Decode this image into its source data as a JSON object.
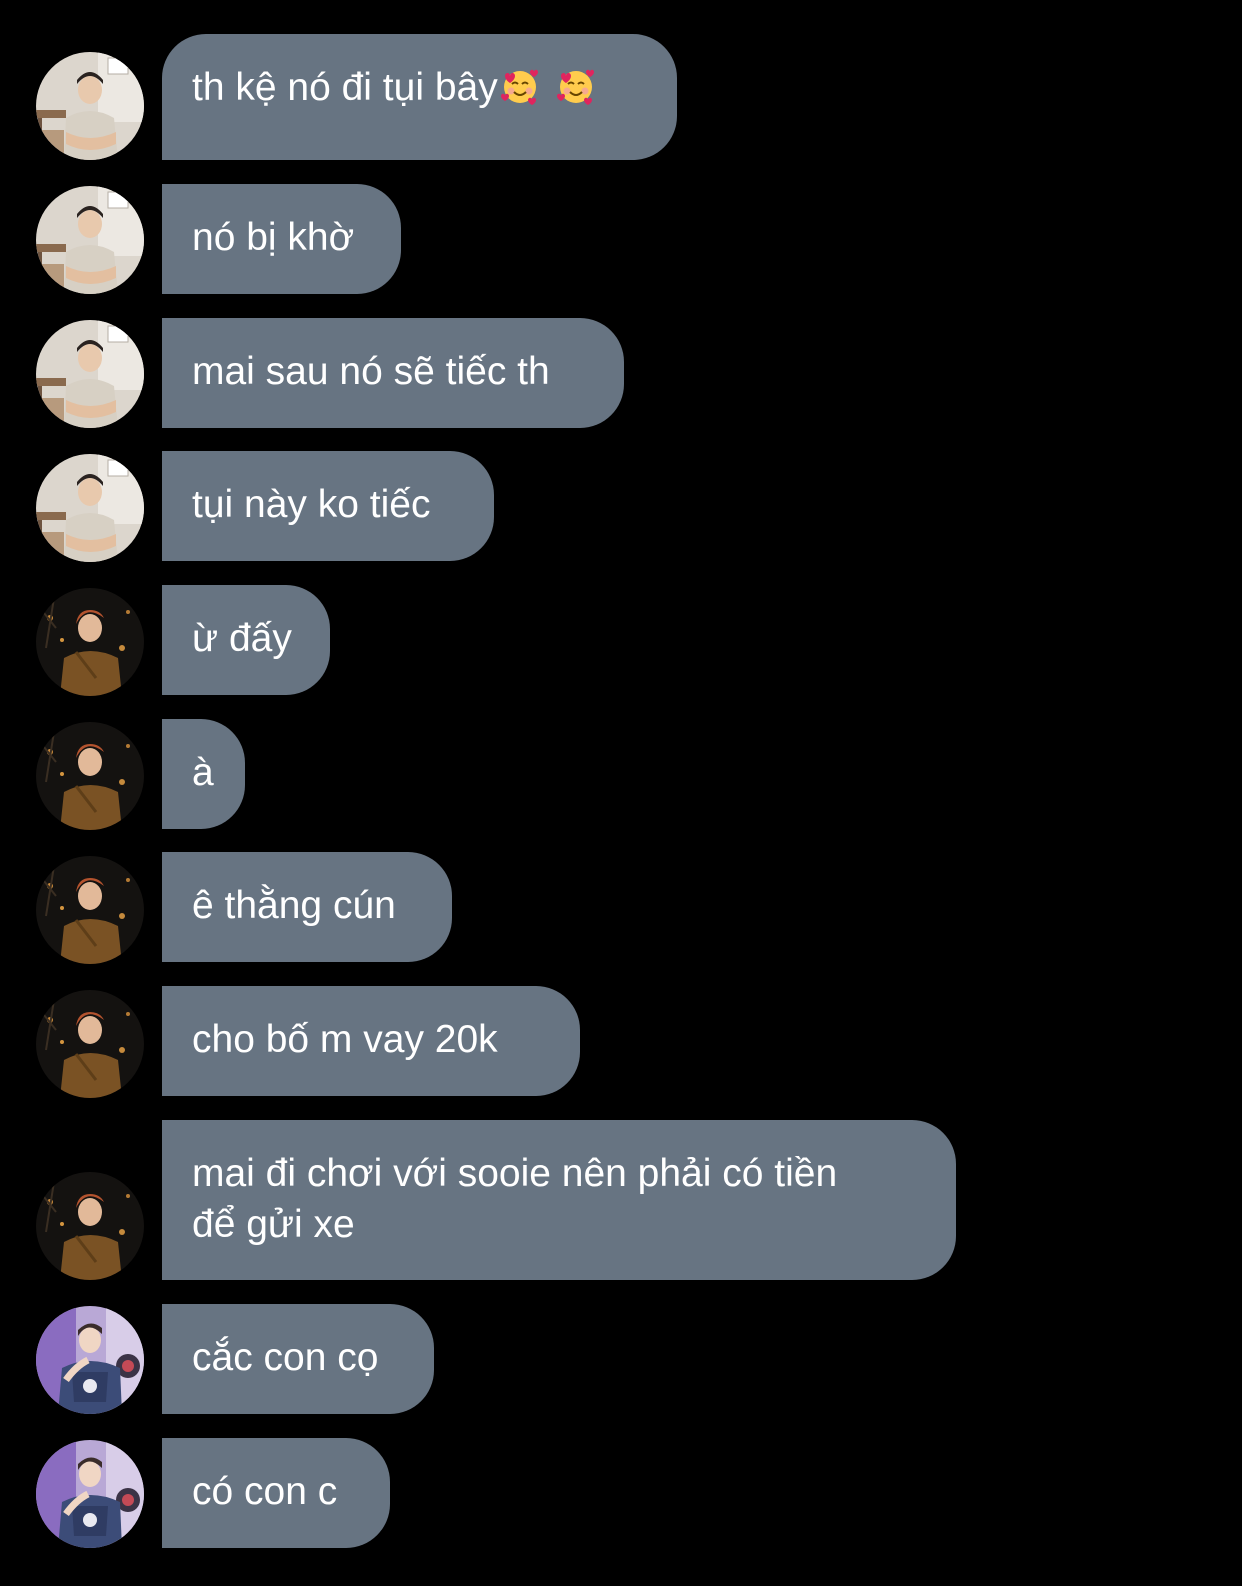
{
  "messages": [
    {
      "sender": "avatar-a",
      "text": "th kệ nó đi tụi bây",
      "emoji": [
        "smiling-face-with-hearts-icon",
        "smiling-face-with-hearts-icon"
      ]
    },
    {
      "sender": "avatar-a",
      "text": "nó bị khờ"
    },
    {
      "sender": "avatar-a",
      "text": "mai sau nó sẽ tiếc th"
    },
    {
      "sender": "avatar-a",
      "text": "tụi này ko tiếc"
    },
    {
      "sender": "avatar-b",
      "text": "ừ đấy"
    },
    {
      "sender": "avatar-b",
      "text": "à"
    },
    {
      "sender": "avatar-b",
      "text": "ê thằng cún"
    },
    {
      "sender": "avatar-b",
      "text": "cho bố m vay 20k"
    },
    {
      "sender": "avatar-b",
      "text_line1": "mai đi chơi với sooie nên phải có tiền",
      "text_line2": "để gửi xe"
    },
    {
      "sender": "avatar-c",
      "text": "cắc con cọ"
    },
    {
      "sender": "avatar-c",
      "text": "có con c"
    }
  ],
  "colors": {
    "background": "#000000",
    "bubble": "#677482",
    "text": "#ffffff"
  }
}
